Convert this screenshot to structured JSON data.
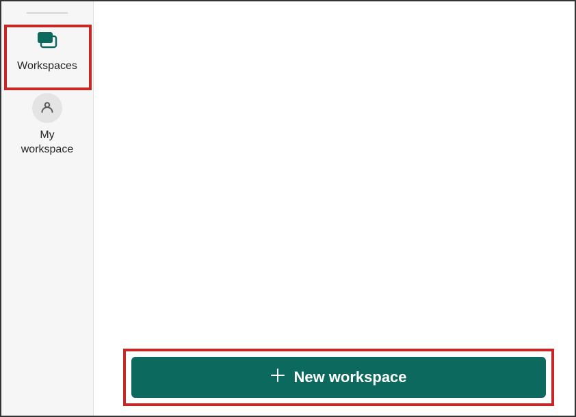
{
  "sidebar": {
    "items": [
      {
        "label": "Workspaces"
      },
      {
        "label": "My\nworkspace"
      }
    ]
  },
  "main": {
    "new_workspace_label": "New workspace"
  },
  "colors": {
    "accent": "#0b6a5d",
    "highlight": "#c62828"
  }
}
